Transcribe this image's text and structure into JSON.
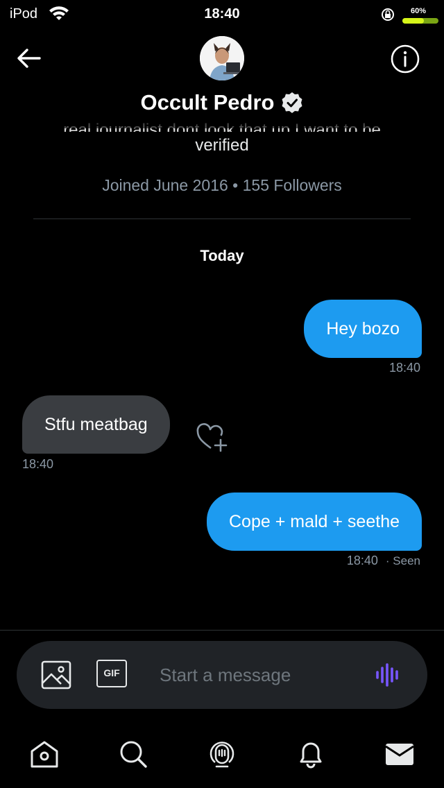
{
  "status_bar": {
    "carrier": "iPod",
    "time": "18:40",
    "battery_percent": "60%",
    "battery_level": 0.6
  },
  "header": {
    "name": "Occult Pedro",
    "bio_cut": "real journalist dont look that up I want to be",
    "bio_end": "verified",
    "joined": "Joined June 2016 • 155 Followers"
  },
  "conversation": {
    "day_label": "Today",
    "messages": [
      {
        "text": "Hey bozo",
        "time": "18:40",
        "direction": "sent"
      },
      {
        "text": "Stfu meatbag",
        "time": "18:40",
        "direction": "received"
      },
      {
        "text": "Cope + mald + seethe",
        "time": "18:40",
        "seen": "· Seen",
        "direction": "sent"
      }
    ]
  },
  "composer": {
    "placeholder": "Start a message",
    "gif_label": "GIF"
  },
  "colors": {
    "accent": "#1d9bf0",
    "received_bubble": "#3a3d41",
    "muted_text": "#8b98a5",
    "voice_icon": "#7856ff"
  },
  "icons": [
    "back-arrow-icon",
    "info-icon",
    "verified-badge-icon",
    "like-add-icon",
    "image-icon",
    "gif-icon",
    "voice-wave-icon",
    "home-icon",
    "search-icon",
    "spaces-icon",
    "bell-icon",
    "mail-icon"
  ]
}
